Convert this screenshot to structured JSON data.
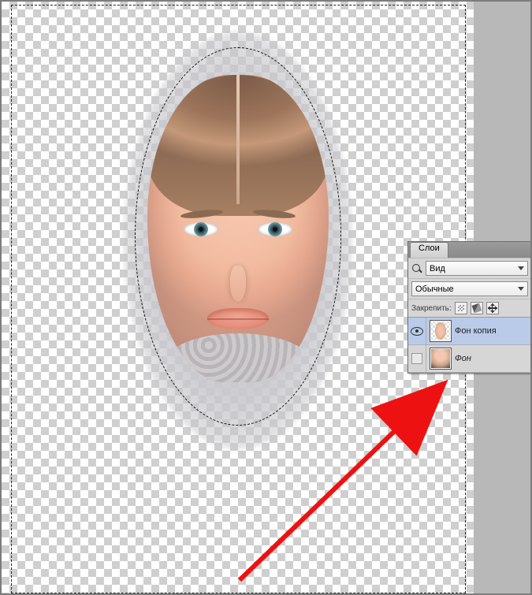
{
  "panel": {
    "tab_label": "Слои",
    "kind_label": "Вид",
    "blend_mode": "Обычные",
    "lock_label": "Закрепить:"
  },
  "layers": [
    {
      "name": "Фон копия",
      "visible": true,
      "selected": true,
      "italic": false
    },
    {
      "name": "Фон",
      "visible": false,
      "selected": false,
      "italic": true
    }
  ]
}
